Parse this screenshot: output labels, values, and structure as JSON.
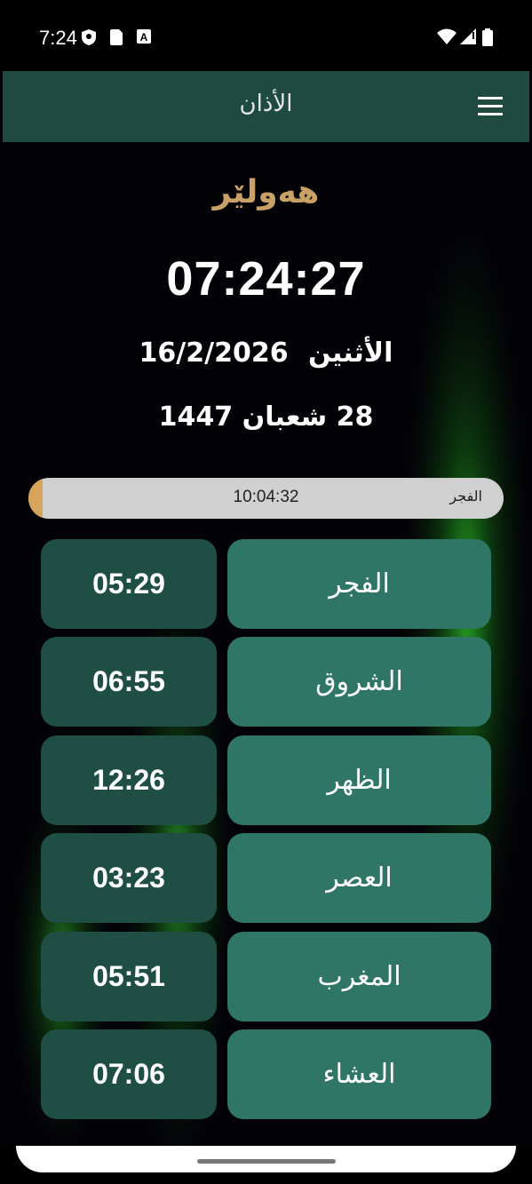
{
  "status_bar": {
    "time": "7:24"
  },
  "app_bar": {
    "title": "الأذان"
  },
  "location": {
    "city": "هەولێر"
  },
  "clock": {
    "time": "07:24:27"
  },
  "date": {
    "weekday": "الأثنين",
    "gregorian": "16/2/2026",
    "hijri": "28 شعبان 1447"
  },
  "next_prayer": {
    "label": "الفجر",
    "countdown": "10:04:32",
    "progress_fraction": 0.03
  },
  "prayers": [
    {
      "name": "الفجر",
      "time": "05:29"
    },
    {
      "name": "الشروق",
      "time": "06:55"
    },
    {
      "name": "الظهر",
      "time": "12:26"
    },
    {
      "name": "العصر",
      "time": "03:23"
    },
    {
      "name": "المغرب",
      "time": "05:51"
    },
    {
      "name": "العشاء",
      "time": "07:06"
    }
  ],
  "colors": {
    "app_bar": "#1e4a40",
    "prayer_name_bg": "#2f7666",
    "prayer_time_bg": "#1f4e45",
    "city_text": "#c9a066",
    "progress_fill": "#d8a35a"
  },
  "icons": {
    "menu": "hamburger-menu-icon"
  }
}
